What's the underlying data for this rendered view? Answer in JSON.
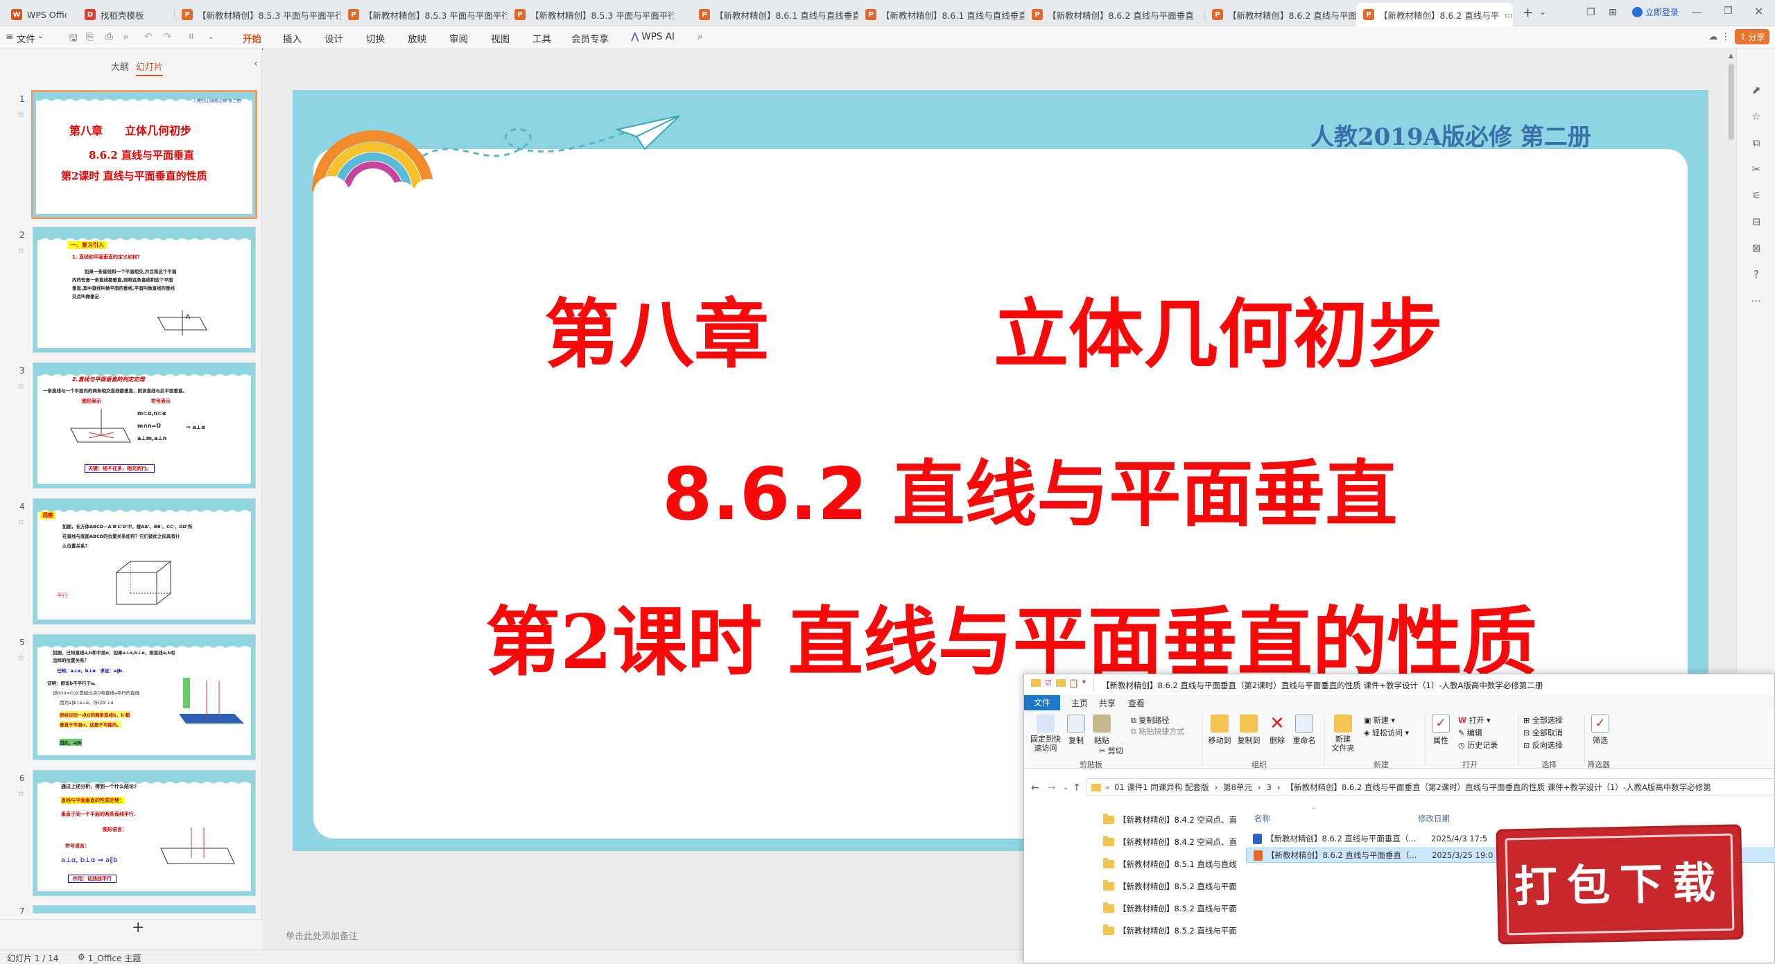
{
  "tabs": [
    {
      "label": "WPS Office",
      "icon": "wps-logo-icon",
      "color": "#d9541e"
    },
    {
      "label": "找稻壳模板",
      "icon": "docer-icon",
      "color": "#e33b2e"
    },
    {
      "label": "【新教材精创】8.5.3 平面与平面平行",
      "icon": "ppt-icon",
      "color": "#e4682a"
    },
    {
      "label": "【新教材精创】8.5.3 平面与平面平行",
      "icon": "ppt-icon",
      "color": "#e4682a"
    },
    {
      "label": "【新教材精创】8.5.3 平面与平面平行",
      "icon": "ppt-icon",
      "color": "#e4682a"
    },
    {
      "label": "【新教材精创】8.6.1 直线与直线垂直",
      "icon": "ppt-icon",
      "color": "#e4682a"
    },
    {
      "label": "【新教材精创】8.6.1 直线与直线垂直",
      "icon": "ppt-icon",
      "color": "#e4682a"
    },
    {
      "label": "【新教材精创】8.6.2 直线与平面垂直",
      "icon": "ppt-icon",
      "color": "#e4682a"
    },
    {
      "label": "【新教材精创】8.6.2 直线与平面垂直",
      "icon": "ppt-icon",
      "color": "#e4682a"
    },
    {
      "label": "【新教材精创】8.6.2 直线与平",
      "icon": "ppt-icon",
      "color": "#e4682a"
    }
  ],
  "login_label": "立即登录",
  "menu": {
    "file": "文件",
    "items": [
      "开始",
      "插入",
      "设计",
      "切换",
      "放映",
      "审阅",
      "视图",
      "工具",
      "会员专享"
    ],
    "ai": "WPS AI",
    "share": "分享"
  },
  "left_panel": {
    "tab_outline": "大纲",
    "tab_slides": "幻灯片",
    "add": "+"
  },
  "thumbs": [
    {
      "num": "1",
      "lines": [
        "第八章　　立体几何初步",
        "8.6.2 直线与平面垂直",
        "第2课时 直线与平面垂直的性质"
      ],
      "header": "人教2019A版必修 第二册"
    },
    {
      "num": "2",
      "lines": [
        "一、复习引入",
        "1. 直线和平面垂直的定义如何？",
        "如果一条直线和一个平面相交,并且和这个平面",
        "内的任意一条直线都垂直,则称这条直线和这个平面",
        "垂直.其中直线叫做平面的垂线,平面叫做直线的垂线",
        "交点叫做垂足."
      ]
    },
    {
      "num": "3",
      "lines": [
        "2.直线与平面垂直的判定定理",
        "一条直线与一个平面内的两条相交直线都垂直，则该直线与此平面垂直。",
        "图形表示",
        "符号表示",
        "m⊂α,n⊂α",
        "m∩n=O",
        "⇒ a⊥α",
        "a⊥m,a⊥n",
        "关键：线不在多，相交则行。"
      ]
    },
    {
      "num": "4",
      "lines": [
        "观察",
        "如图，长方体ABCD—A'B'C'D'中，棱AA'、BB'、CC'、DD'所",
        "在直线与底面ABCD的位置关系如何？它们彼此之间具有什",
        "么位置关系？",
        "平行"
      ]
    },
    {
      "num": "5",
      "lines": [
        "如图，已知直线a,b和平面α，如果a⊥α,b⊥α，则直线a,b有",
        "怎样的位置关系？",
        "已知：a⊥α，b⊥α　求证：a∥b.",
        "证明：假设b不平行于a,",
        "设b∩α=O,b'是经过点O与直线a平行的直线",
        "因为a∥b',a⊥α，所以b'⊥α",
        "即经过同一点O的两条直线b，b'都",
        "垂直于平面α，这是不可能的。",
        "因此，a∥b"
      ]
    },
    {
      "num": "6",
      "lines": [
        "通过上述分析，得到一个什么结论?",
        "直线与平面垂直的性质定理：",
        "垂直于同一个平面的两条直线平行.",
        "图形语言：",
        "符号语言：",
        "a⊥α, b⊥α ⇒ a∥b",
        "作用：证线线平行"
      ]
    },
    {
      "num": "7",
      "lines": []
    }
  ],
  "slide": {
    "header": "人教2019A版必修 第二册",
    "chapter": "第八章　　　立体几何初步",
    "section": "8.6.2 直线与平面垂直",
    "lesson": "第2课时 直线与平面垂直的性质",
    "notes_placeholder": "单击此处添加备注"
  },
  "status": {
    "slide_index": "幻灯片 1 / 14",
    "theme": "1_Office 主题"
  },
  "explorer": {
    "title": "【新教材精创】8.6.2 直线与平面垂直（第2课时）直线与平面垂直的性质 课件+教学设计（1）-人教A版高中数学必修第二册",
    "tabs": [
      "文件",
      "主页",
      "共享",
      "查看"
    ],
    "ribbon": {
      "pin": "固定到快\n速访问",
      "copy": "复制",
      "paste": "粘贴",
      "copy_path": "复制路径",
      "paste_shortcut": "粘贴快捷方式",
      "cut": "剪切",
      "clipboard": "剪贴板",
      "move_to": "移动到",
      "copy_to": "复制到",
      "delete": "删除",
      "rename": "重命名",
      "organize": "组织",
      "new_folder": "新建\n文件夹",
      "new_item": "新建",
      "easy_access": "轻松访问",
      "new": "新建",
      "properties": "属性",
      "open": "打开",
      "edit": "编辑",
      "history": "历史记录",
      "open_group": "打开",
      "select_all": "全部选择",
      "select_none": "全部取消",
      "invert": "反向选择",
      "select_group": "选择",
      "filter": "筛选",
      "filter_group": "筛选器"
    },
    "breadcrumb": [
      "01 课件1 同课异构 配套版",
      "第8单元",
      "3",
      "【新教材精创】8.6.2 直线与平面垂直（第2课时）直线与平面垂直的性质 课件+教学设计（1）-人教A版高中数学必修第"
    ],
    "folders": [
      "【新教材精创】8.4.2 空间点、直",
      "【新教材精创】8.4.2 空间点、直",
      "【新教材精创】8.5.1 直线与直线",
      "【新教材精创】8.5.2 直线与平面",
      "【新教材精创】8.5.2 直线与平面",
      "【新教材精创】8.5.2 直线与平面"
    ],
    "columns": {
      "name": "名称",
      "modified": "修改日期"
    },
    "files": [
      {
        "name": "【新教材精创】8.6.2 直线与平面垂直（...",
        "date": "2025/4/3 17:5",
        "type": "docx"
      },
      {
        "name": "【新教材精创】8.6.2 直线与平面垂直（...",
        "date": "2025/3/25 19:0",
        "type": "pptx"
      }
    ]
  },
  "download_badge": "打包下载"
}
